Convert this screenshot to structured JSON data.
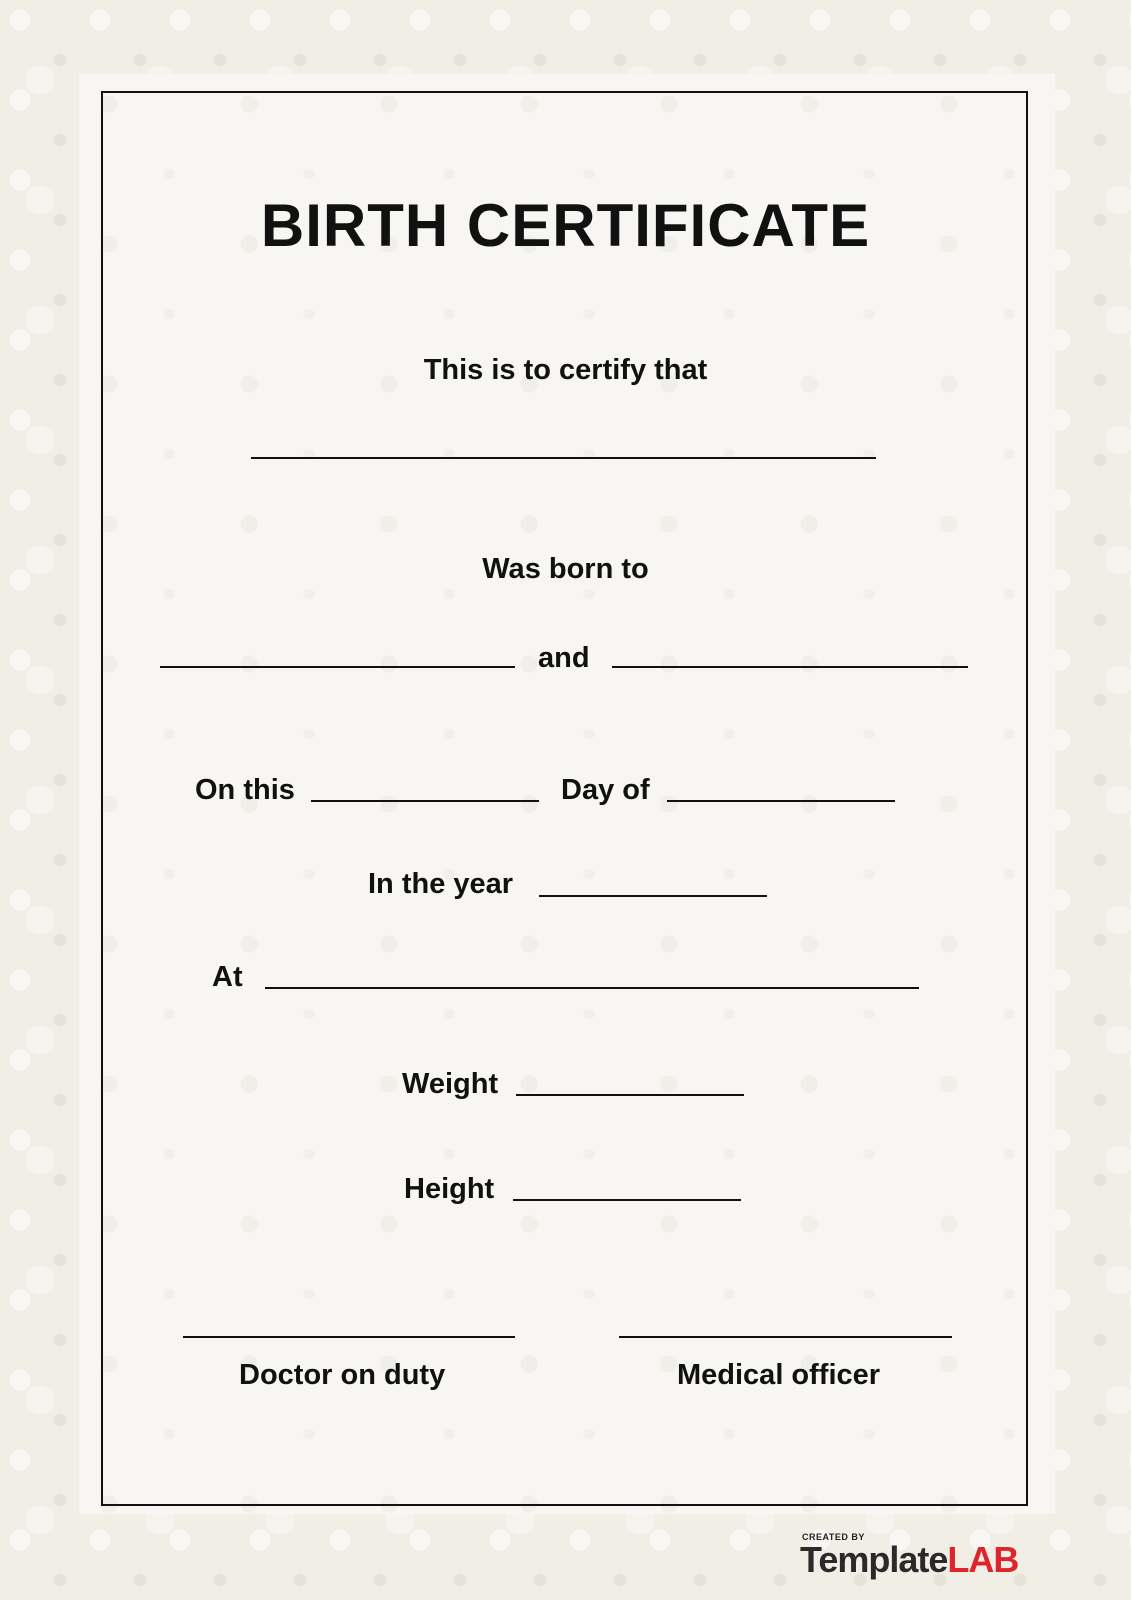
{
  "certificate": {
    "title": "BIRTH CERTIFICATE",
    "certify_text": "This is to certify that",
    "born_to_text": "Was born to",
    "and_text": "and",
    "on_this_label": "On this",
    "day_of_label": "Day of",
    "year_label": "In the year",
    "at_label": "At",
    "weight_label": "Weight",
    "height_label": "Height",
    "signature_left_label": "Doctor on duty",
    "signature_right_label": "Medical officer"
  },
  "branding": {
    "created_by": "CREATED BY",
    "name_part1": "Template",
    "name_part2": "LAB",
    "accent_color": "#e0242c"
  }
}
